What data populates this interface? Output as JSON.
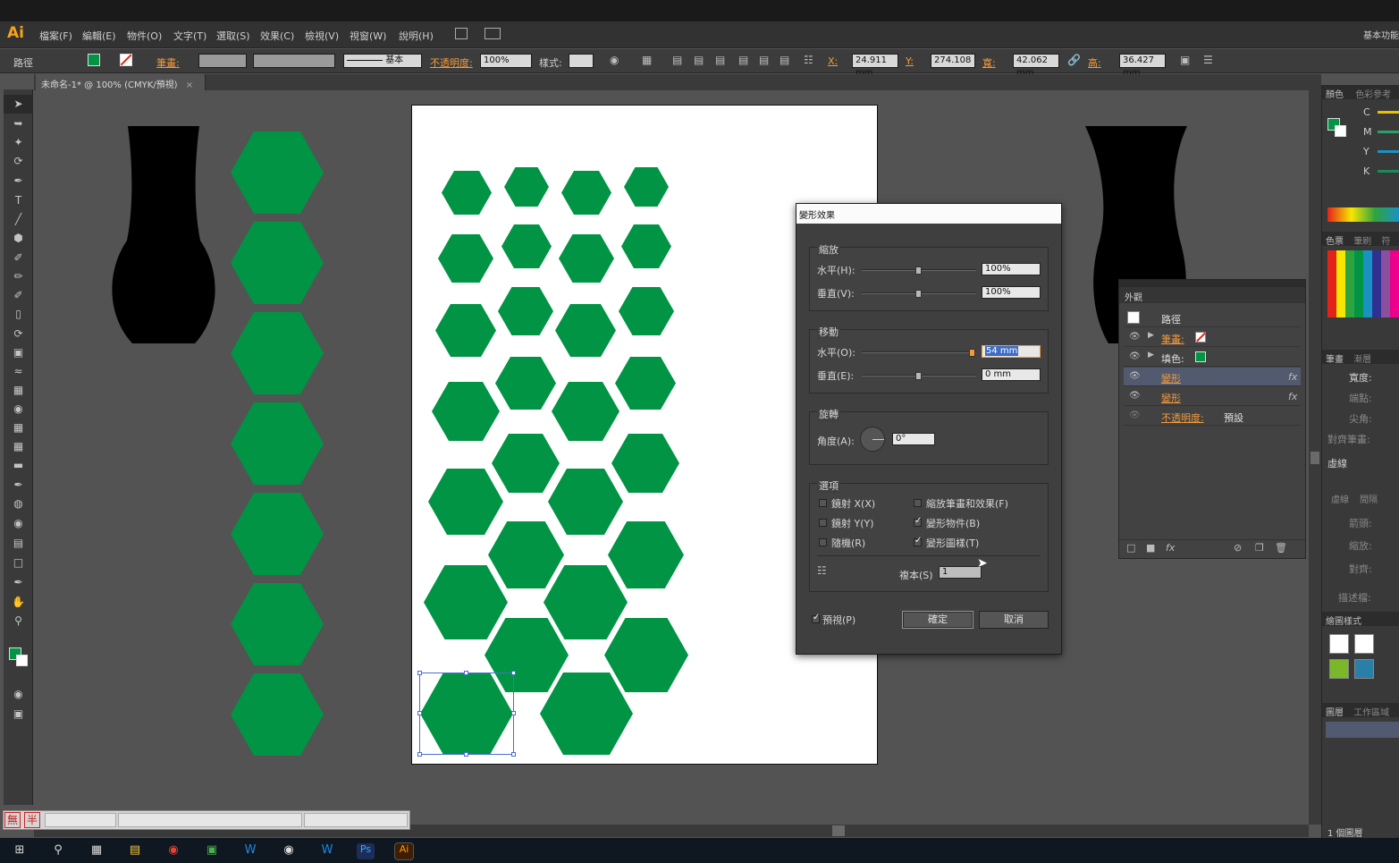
{
  "app": {
    "logo": "Ai",
    "workspace": "基本功能"
  },
  "menu": [
    "檔案(F)",
    "編輯(E)",
    "物件(O)",
    "文字(T)",
    "選取(S)",
    "效果(C)",
    "檢視(V)",
    "視窗(W)",
    "說明(H)"
  ],
  "control": {
    "object_type": "路徑",
    "stroke_label": "筆畫:",
    "stroke_style": "基本",
    "opacity_label": "不透明度:",
    "opacity_value": "100%",
    "style_label": "樣式:",
    "x_label": "X:",
    "x_value": "24.911 mm",
    "y_label": "Y:",
    "y_value": "274.108",
    "w_label": "寬:",
    "w_value": "42.062 mm",
    "h_label": "高:",
    "h_value": "36.427 mm"
  },
  "document": {
    "tab_title": "未命名-1* @ 100% (CMYK/預視)",
    "close": "×"
  },
  "colors": {
    "fill": "#009444",
    "panel": "#424242",
    "accent": "#f39a3a",
    "selection": "#4a6fd1"
  },
  "dialog": {
    "title": "變形效果",
    "scale": {
      "title": "縮放",
      "h_label": "水平(H):",
      "h_value": "100%",
      "v_label": "垂直(V):",
      "v_value": "100%"
    },
    "move": {
      "title": "移動",
      "h_label": "水平(O):",
      "h_value": "54 mm",
      "v_label": "垂直(E):",
      "v_value": "0 mm"
    },
    "rotate": {
      "title": "旋轉",
      "angle_label": "角度(A):",
      "angle_value": "0°"
    },
    "options": {
      "title": "選項",
      "reflect_x": "鏡射 X(X)",
      "reflect_x_checked": false,
      "reflect_y": "鏡射 Y(Y)",
      "reflect_y_checked": false,
      "random": "隨機(R)",
      "random_checked": false,
      "scale_strokes": "縮放筆畫和效果(F)",
      "scale_strokes_checked": false,
      "transform_objects": "變形物件(B)",
      "transform_objects_checked": true,
      "transform_patterns": "變形圖樣(T)",
      "transform_patterns_checked": true,
      "copies_label": "複本(S)",
      "copies_value": "1"
    },
    "preview_label": "預視(P)",
    "preview_checked": true,
    "ok": "確定",
    "cancel": "取消"
  },
  "appearance": {
    "tab": "外觀",
    "object": "路徑",
    "rows": [
      {
        "label": "筆畫:",
        "type": "stroke"
      },
      {
        "label": "填色:",
        "type": "fill"
      },
      {
        "label": "變形",
        "type": "effect",
        "fx": "fx",
        "selected": true
      },
      {
        "label": "變形",
        "type": "effect",
        "fx": "fx",
        "selected": false
      },
      {
        "label": "不透明度:",
        "type": "opacity",
        "value": "預設"
      }
    ]
  },
  "right_dock": {
    "color_tab": "顏色",
    "color_guide_tab": "色彩參考",
    "cmyk": [
      "C",
      "M",
      "Y",
      "K"
    ],
    "swatches_tab": "色票",
    "brushes_tab": "筆刷",
    "symbols_tab": "符",
    "stroke_tab": "筆畫",
    "gradient_tab": "漸層",
    "weight_label": "寬度:",
    "cap_label": "端點:",
    "corner_label": "尖角:",
    "align_label": "對齊筆畫:",
    "dashed_label": "虛線",
    "dash": "虛線",
    "gap": "間隔",
    "arrows_label": "箭頭:",
    "scale_label": "縮放:",
    "align2_label": "對齊:",
    "profile_label": "描述檔:",
    "graphic_styles_tab": "繪圖樣式",
    "layers_tab": "圖層",
    "artboards_tab": "工作區域",
    "layer_count": "1 個圖層"
  },
  "ime": {
    "mode1": "無",
    "mode2": "半"
  },
  "taskbar": [
    "windows-start",
    "search",
    "task-view",
    "file-explorer",
    "chrome",
    "app",
    "wave",
    "obs",
    "wave2",
    "photoshop",
    "illustrator"
  ]
}
